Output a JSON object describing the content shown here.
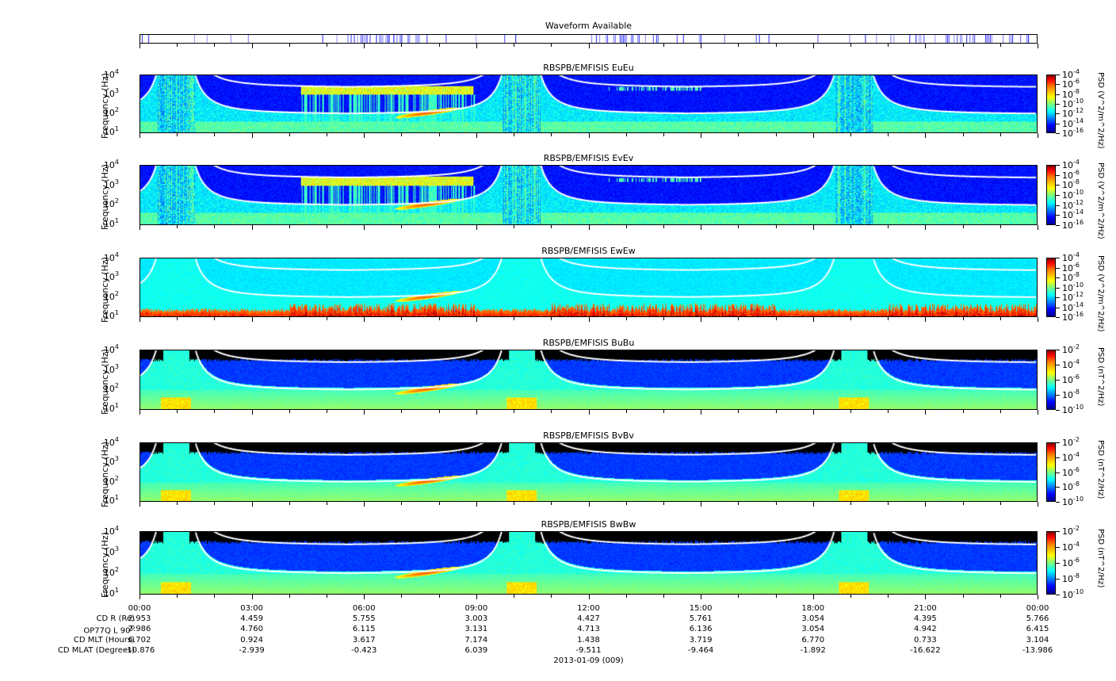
{
  "waveform": {
    "title": "Waveform Available",
    "color": "#0000ff"
  },
  "panels": [
    {
      "title": "RBSPB/EMFISIS  EuEu",
      "type": "E",
      "ylabel": "Frequency (Hz)",
      "cbar_label": "PSD (V^2/m^2/Hz)",
      "cbar_exponents": [
        "-4",
        "-6",
        "-8",
        "-10",
        "-12",
        "-14",
        "-16"
      ]
    },
    {
      "title": "RBSPB/EMFISIS  EvEv",
      "type": "E",
      "ylabel": "Frequency (Hz)",
      "cbar_label": "PSD (V^2/m^2/Hz)",
      "cbar_exponents": [
        "-4",
        "-6",
        "-8",
        "-10",
        "-12",
        "-14",
        "-16"
      ]
    },
    {
      "title": "RBSPB/EMFISIS  EwEw",
      "type": "Ew",
      "ylabel": "Frequency (Hz)",
      "cbar_label": "PSD (V^2/m^2/Hz)",
      "cbar_exponents": [
        "-4",
        "-6",
        "-8",
        "-10",
        "-12",
        "-14",
        "-16"
      ]
    },
    {
      "title": "RBSPB/EMFISIS  BuBu",
      "type": "B",
      "ylabel": "Frequency (Hz)",
      "cbar_label": "PSD (nT^2/Hz)",
      "cbar_exponents": [
        "-2",
        "-4",
        "-6",
        "-8",
        "-10"
      ]
    },
    {
      "title": "RBSPB/EMFISIS  BvBv",
      "type": "B",
      "ylabel": "Frequency (Hz)",
      "cbar_label": "PSD (nT^2/Hz)",
      "cbar_exponents": [
        "-2",
        "-4",
        "-6",
        "-8",
        "-10"
      ]
    },
    {
      "title": "RBSPB/EMFISIS  BwBw",
      "type": "B",
      "ylabel": "Frequency (Hz)",
      "cbar_label": "PSD (nT^2/Hz)",
      "cbar_exponents": [
        "-2",
        "-4",
        "-6",
        "-8",
        "-10"
      ]
    }
  ],
  "chart_data": {
    "type": "heatmap",
    "title": "RBSPB/EMFISIS spectrograms",
    "xlabel": "2013-01-09 (009)",
    "ylabel": "Frequency (Hz)",
    "ylim": [
      10,
      10000
    ],
    "yscale": "log",
    "y_tick_exponents": [
      "4",
      "3",
      "2",
      "1"
    ],
    "y_tick_base": "10",
    "xlim_hours": [
      0,
      24
    ],
    "x_tick_labels": [
      "00:00",
      "03:00",
      "06:00",
      "09:00",
      "12:00",
      "15:00",
      "18:00",
      "21:00",
      "00:00"
    ],
    "ephemeris_rows": [
      {
        "label": "CD R (Re)",
        "values": [
          "2.953",
          "4.459",
          "5.755",
          "3.003",
          "4.427",
          "5.761",
          "3.054",
          "4.395",
          "5.766"
        ]
      },
      {
        "label": "OP77Q L 90",
        "label_sup": "O",
        "values": [
          "2.986",
          "4.760",
          "6.115",
          "3.131",
          "4.713",
          "6.136",
          "3.054",
          "4.942",
          "6.415"
        ]
      },
      {
        "label": "CD MLT (Hours)",
        "values": [
          "6.702",
          "0.924",
          "3.617",
          "7.174",
          "1.438",
          "3.719",
          "6.770",
          "0.733",
          "3.104"
        ]
      },
      {
        "label": "CD MLAT (Degrees)",
        "values": [
          "-10.876",
          "-2.939",
          "-0.423",
          "6.039",
          "-9.511",
          "-9.464",
          "-1.892",
          "-16.622",
          "-13.986"
        ]
      }
    ],
    "date_label": "2013-01-09 (009)"
  }
}
